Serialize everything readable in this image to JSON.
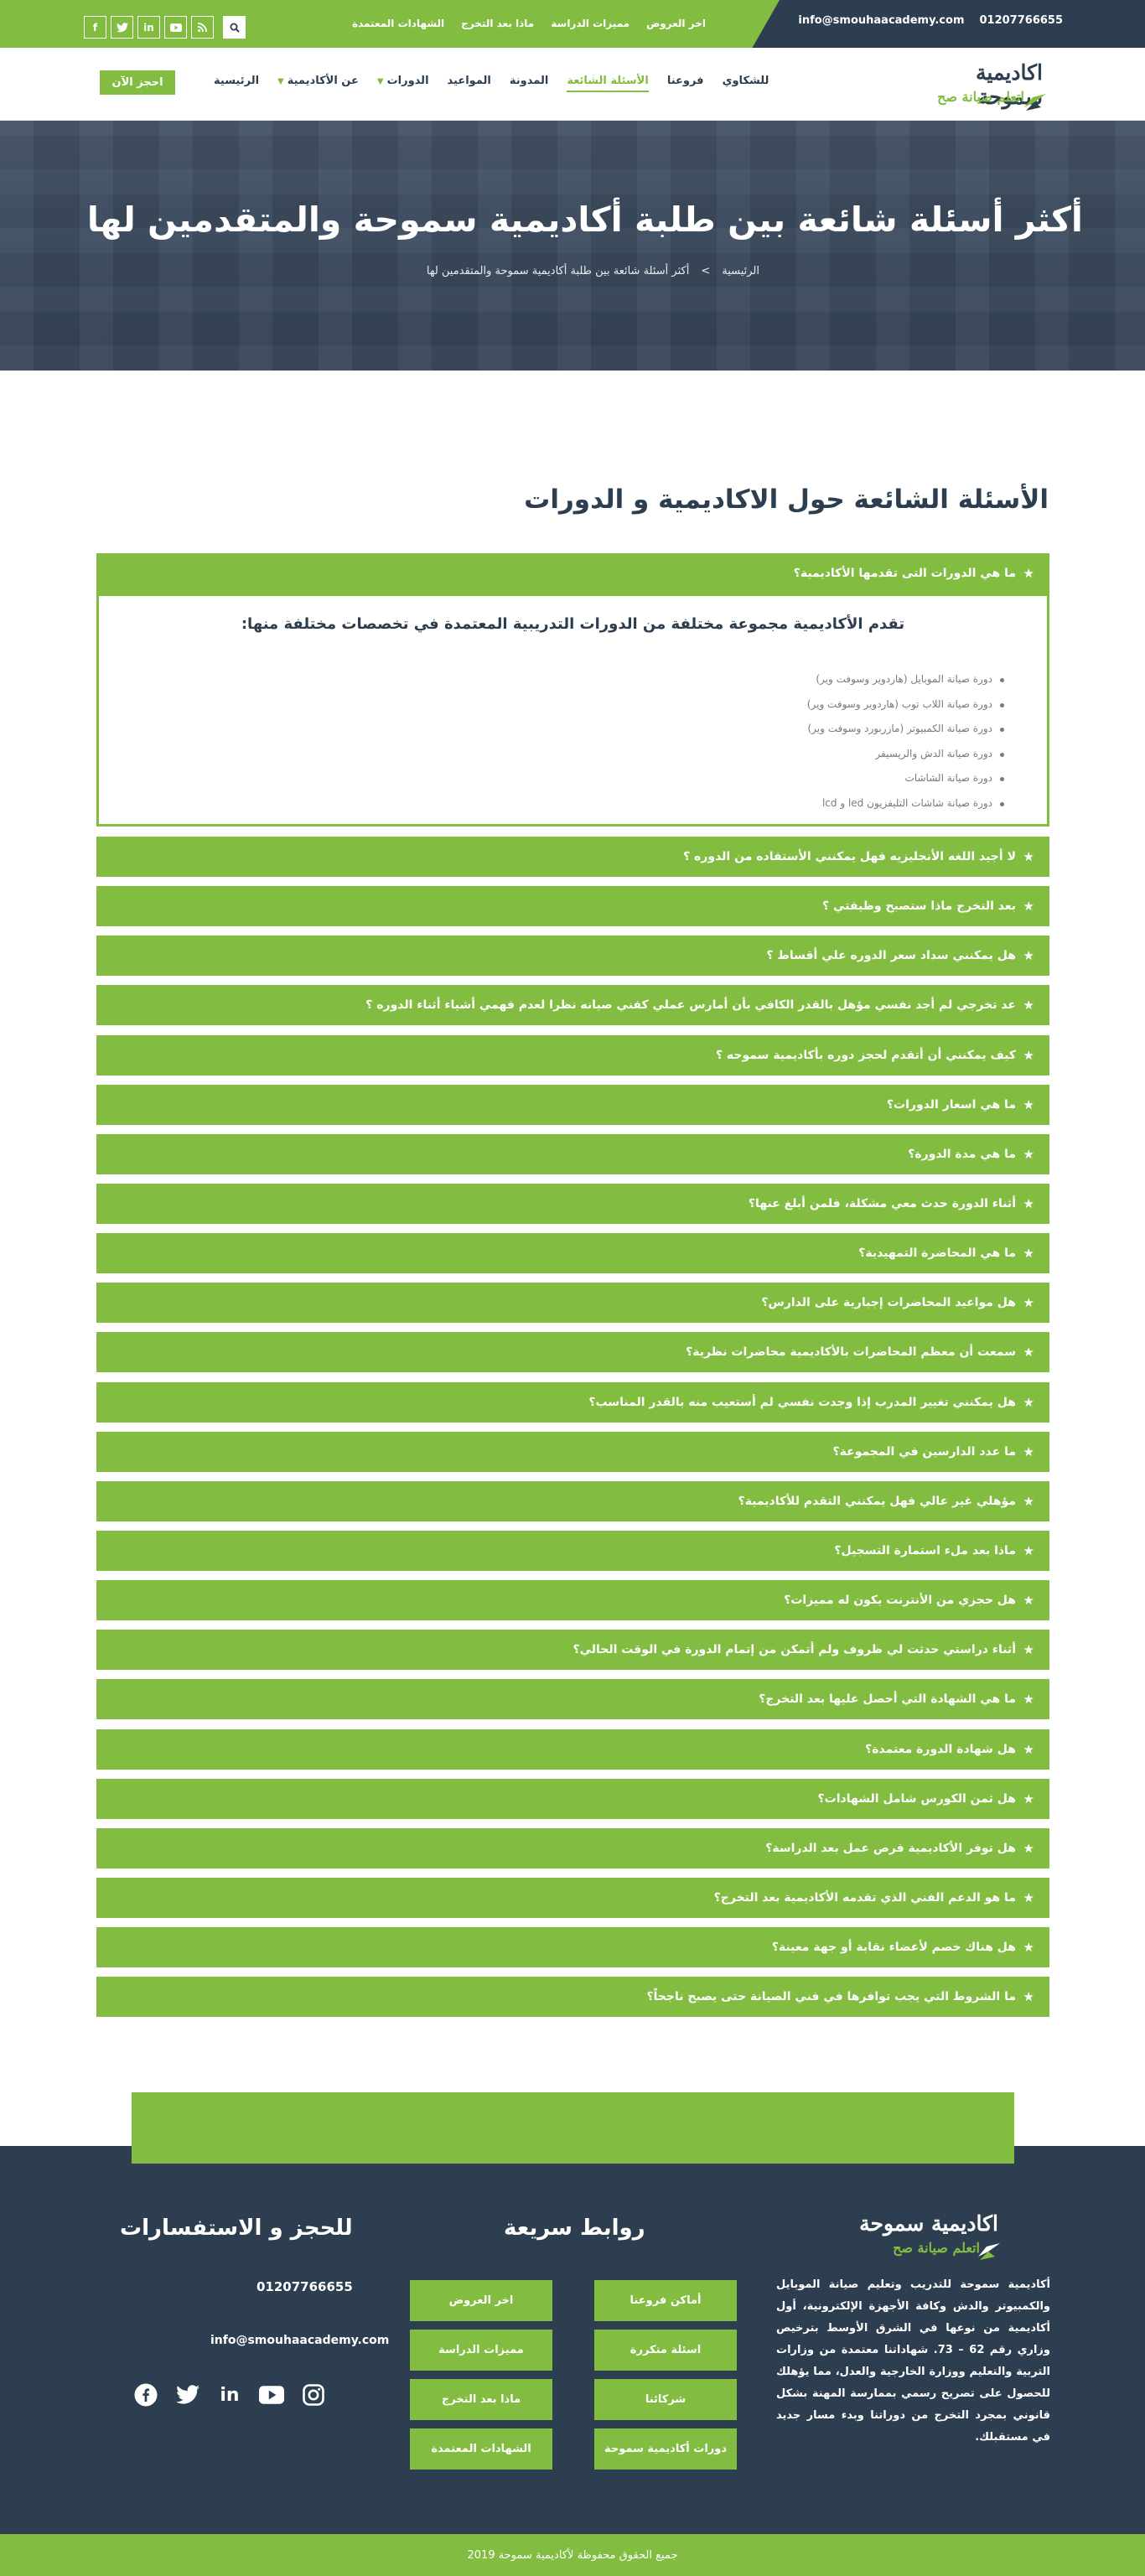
{
  "topbar": {
    "email": "info@smouhaacademy.com",
    "phone": "01207766655",
    "links": [
      "اخر العروض",
      "مميزات الدراسة",
      "ماذا بعد التخرج",
      "الشهادات المعتمدة"
    ],
    "social": [
      "facebook-icon",
      "twitter-icon",
      "linkedin-icon",
      "youtube-icon",
      "rss-icon",
      "search-icon"
    ]
  },
  "nav": {
    "logo_line1": "اكاديمية سموحة",
    "logo_line2": "اتعلم صيانة صح",
    "items": [
      "الرئيسية",
      "عن الأكاديمية",
      "الدورات",
      "المواعيد",
      "المدونة",
      "الأسئلة الشائعة",
      "فروعنا",
      "للشكاوي"
    ],
    "book_button": "احجز الآن"
  },
  "hero": {
    "title": "أكثر أسئلة شائعة بين طلبة أكاديمية سموحة والمتقدمين لها",
    "breadcrumb_home": "الرئيسية",
    "breadcrumb_sep": ">",
    "breadcrumb_current": "أكثر أسئلة شائعة بين طلبة أكاديمية سموحة والمتقدمين لها"
  },
  "faq": {
    "section_title": "الأسئلة الشائعة حول الاكاديمية و الدورات",
    "open_question": "ما هي الدورات التى تقدمها الأكاديمية؟",
    "open_answer_title": "تقدم الأكاديمية مجموعة مختلفة من الدورات التدريبية المعتمدة في تخصصات مختلفة منها:",
    "open_answer_items": [
      "دورة صيانة الموبايل (هاردوير وسوفت وير)",
      "دورة صيانة اللاب توب (هاردوير وسوفت وير)",
      "دورة صيانة الكمبيوتر (مازربورد وسوفت وير)",
      "دورة صيانة الدش والريسيفر",
      "دورة صيانة الشاشات",
      "دورة صيانة شاشات التليفزيون led و lcd"
    ],
    "questions": [
      "لا أجيد اللغه الأنجليزيه فهل يمكنني الأستفاده من الدوره ؟",
      "بعد التخرج ماذا ستصبح وظيفتي ؟",
      "هل يمكنني سداد سعر الدوره علي أقساط ؟",
      "عد تخرجي لم أجد نفسي مؤهل بالقدر الكافي بأن أمارس عملي كفني صيانه نظرا لعدم فهمي أشياء أثناء الدوره ؟",
      "كيف يمكنني أن أتقدم لحجز دوره بأكاديمية سموحه ؟",
      "ما هي اسعار الدورات؟",
      "ما هي مدة الدورة؟",
      "أثناء الدورة حدث معي مشكلة، فلمن أبلغ عنها؟",
      "ما هي المحاضرة التمهيدية؟",
      "هل مواعيد المحاضرات إجبارية على الدارس؟",
      "سمعت أن معظم المحاضرات بالأكاديمية محاضرات نظرية؟",
      "هل يمكنني تغيير المدرب إذا وجدت نفسي لم أستعيب منه بالقدر المناسب؟",
      "ما عدد الدارسين في المجموعة؟",
      "مؤهلي غير عالي فهل يمكنني التقدم للأكاديمية؟",
      "ماذا بعد ملء استمارة التسجيل؟",
      "هل حجزي من الأنترنت يكون له مميزات؟",
      "أثناء دراستي حدثت لي ظروف ولم أتمكن من إتمام الدورة في الوقت الحالي؟",
      "ما هي الشهادة التي أحصل عليها بعد التخرج؟",
      "هل شهادة الدورة معتمدة؟",
      "هل ثمن الكورس شامل الشهادات؟",
      "هل توفر الأكاديمية فرص عمل بعد الدراسة؟",
      "ما هو الدعم الفني الذي تقدمه الأكاديمية بعد التخرج؟",
      "هل هناك خصم لأعضاء نقابة أو جهة معينة؟",
      "ما الشروط التي يجب توافرها في فني الصيانة حتى يصبح ناجحاً؟"
    ]
  },
  "footer": {
    "logo_line1": "اكاديمية سموحة",
    "logo_line2": "اتعلم صيانة صح",
    "about": "أكاديمية سموحة للتدريب وتعليم صيانة الموبايل والكمبيوتر والدش وكافة الأجهزة الإلكترونية، أول أكاديمية من نوعها في الشرق الأوسط بترخيص وزاري رقم 62 – 73. شهاداتنا معتمدة من وزارات التربية والتعليم ووزارة الخارجية والعدل، مما يؤهلك للحصول على تصريح رسمي بممارسة المهنة بشكل قانوني بمجرد التخرج من دوراتنا وبدء مسار جديد في مستقبلك.",
    "quick_links_title": "روابط سريعة",
    "quick_links": [
      "أماكن فروعنا",
      "اخر العروض",
      "اسئلة متكررة",
      "مميزات الدراسة",
      "شركائنا",
      "ماذا بعد التخرج",
      "دورات أكاديمية سموحة",
      "الشهادات المعتمدة"
    ],
    "contact_title": "للحجز و الاستفسارات",
    "phone": "01207766655",
    "email": "info@smouhaacademy.com",
    "social": [
      "facebook-icon",
      "twitter-icon",
      "linkedin-icon",
      "youtube-icon",
      "instagram-icon"
    ],
    "copyright": "جميع الحقوق محفوظة لأكاديمية سموحة 2019"
  }
}
